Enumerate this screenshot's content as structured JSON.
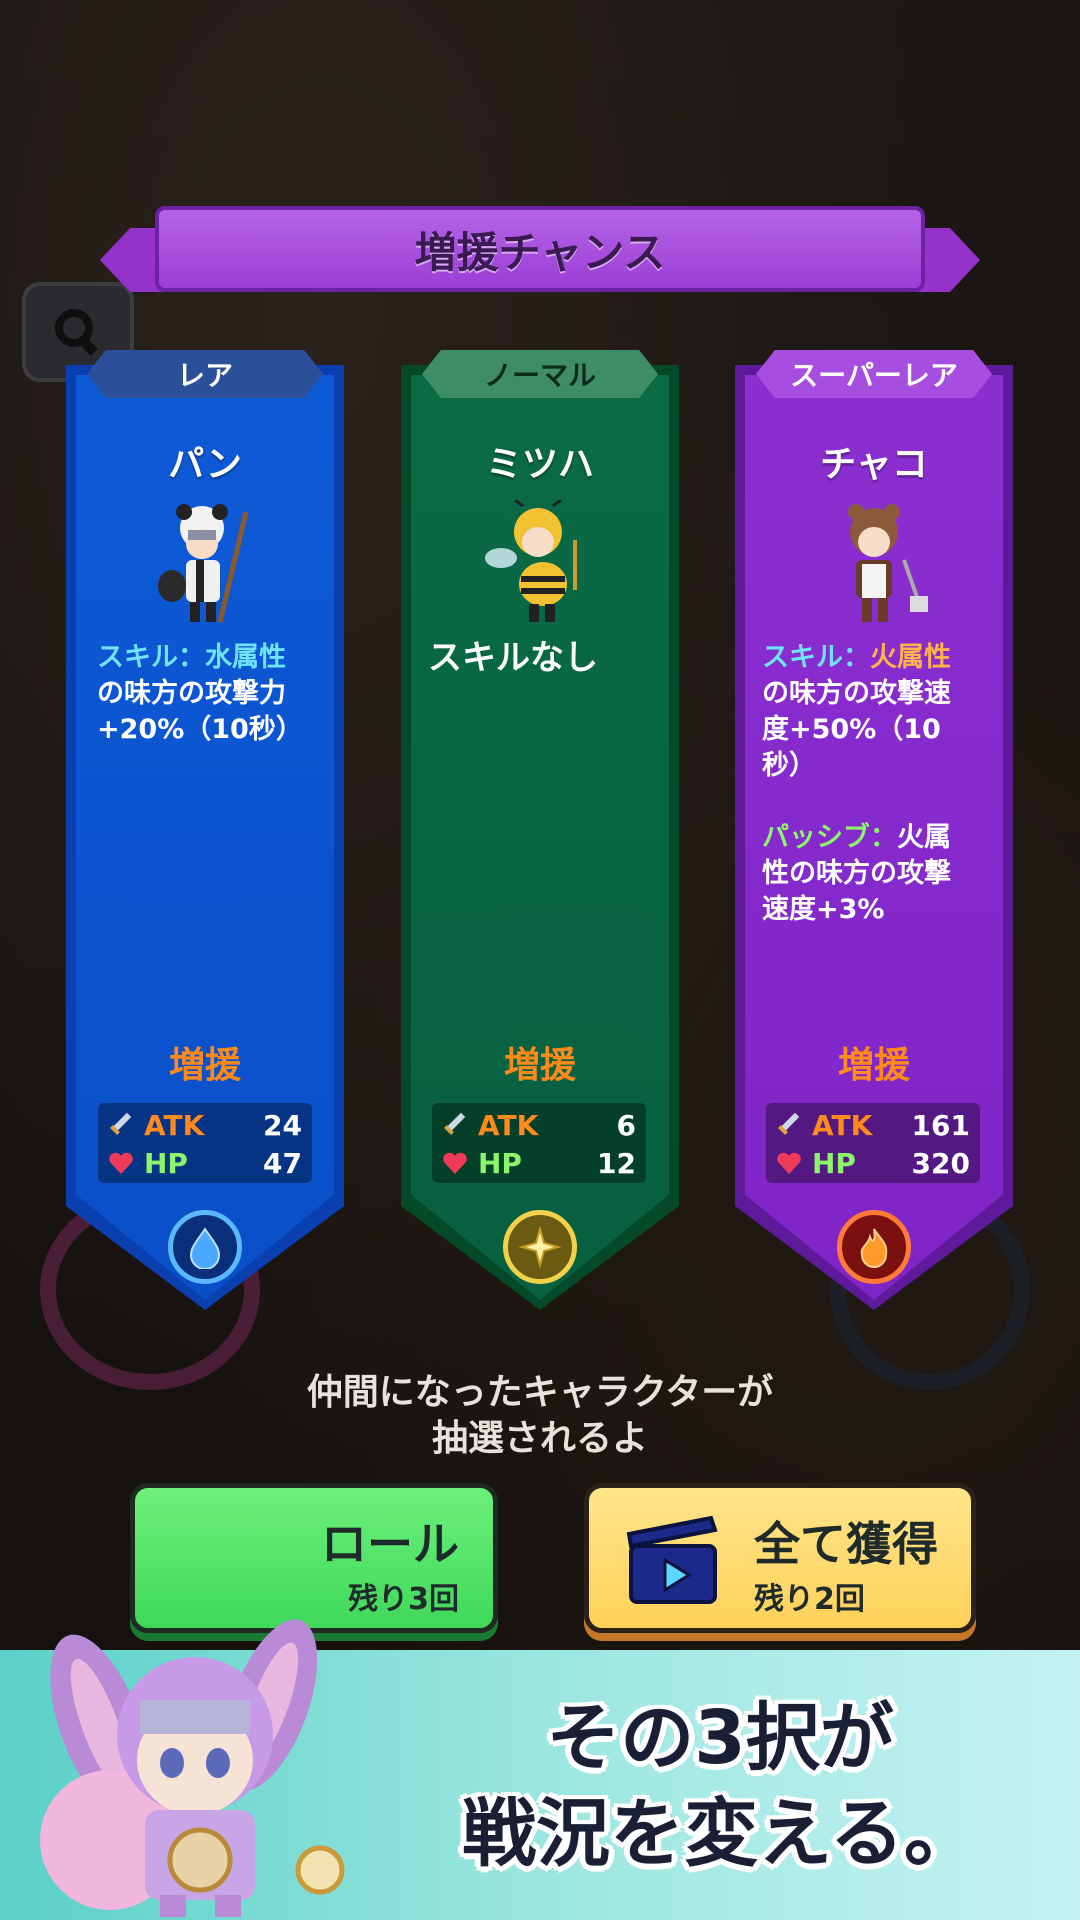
{
  "header": {
    "title": "増援チャンス"
  },
  "search_button": {
    "icon": "search-icon"
  },
  "cards": [
    {
      "rarity": "レア",
      "name": "パン",
      "skill_lines": [
        {
          "parts": [
            {
              "text": "スキル：水属性",
              "style": "hl-blue"
            }
          ]
        },
        {
          "parts": [
            {
              "text": "の味方の攻撃力",
              "style": ""
            }
          ]
        },
        {
          "parts": [
            {
              "text": "+20%（10秒）",
              "style": ""
            }
          ]
        }
      ],
      "reinforce_label": "増援",
      "atk_label": "ATK",
      "atk": "24",
      "hp_label": "HP",
      "hp": "47",
      "element_icon": "water-drop-icon",
      "color": "#0e5ad6"
    },
    {
      "rarity": "ノーマル",
      "name": "ミツハ",
      "skill_lines": [
        {
          "parts": [
            {
              "text": "スキルなし",
              "style": ""
            }
          ]
        }
      ],
      "reinforce_label": "増援",
      "atk_label": "ATK",
      "atk": "6",
      "hp_label": "HP",
      "hp": "12",
      "element_icon": "sparkle-icon",
      "color": "#0a6b45"
    },
    {
      "rarity": "スーパーレア",
      "name": "チャコ",
      "skill_lines": [
        {
          "parts": [
            {
              "text": "スキル：",
              "style": "hl-blue"
            },
            {
              "text": "火属性",
              "style": "hl-orange"
            }
          ]
        },
        {
          "parts": [
            {
              "text": "の味方の攻撃速",
              "style": ""
            }
          ]
        },
        {
          "parts": [
            {
              "text": "度+50%（10",
              "style": ""
            }
          ]
        },
        {
          "parts": [
            {
              "text": "秒）",
              "style": ""
            }
          ]
        },
        {
          "parts": [
            {
              "text": "",
              "style": ""
            }
          ]
        },
        {
          "parts": [
            {
              "text": "パッシブ：",
              "style": "hl-green"
            },
            {
              "text": "火属",
              "style": ""
            }
          ]
        },
        {
          "parts": [
            {
              "text": "性の味方の攻撃",
              "style": ""
            }
          ]
        },
        {
          "parts": [
            {
              "text": "速度+3%",
              "style": ""
            }
          ]
        }
      ],
      "reinforce_label": "増援",
      "atk_label": "ATK",
      "atk": "161",
      "hp_label": "HP",
      "hp": "320",
      "element_icon": "fire-icon",
      "color": "#8b2fd1"
    }
  ],
  "description": "仲間になったキャラクターが\n抽選されるよ",
  "buttons": {
    "reroll": {
      "label": "ロール",
      "sub": "残り3回"
    },
    "get_all": {
      "label": "全て獲得",
      "sub": "残り2回",
      "icon": "video-ad-icon"
    }
  },
  "tagline": {
    "line1": "その3択が",
    "line2": "戦況を変える。"
  },
  "colors": {
    "accent": "#9a3fd6",
    "atk": "#ff8a1c",
    "hp": "#8cf56b",
    "reinforce": "#ff8a1c"
  }
}
